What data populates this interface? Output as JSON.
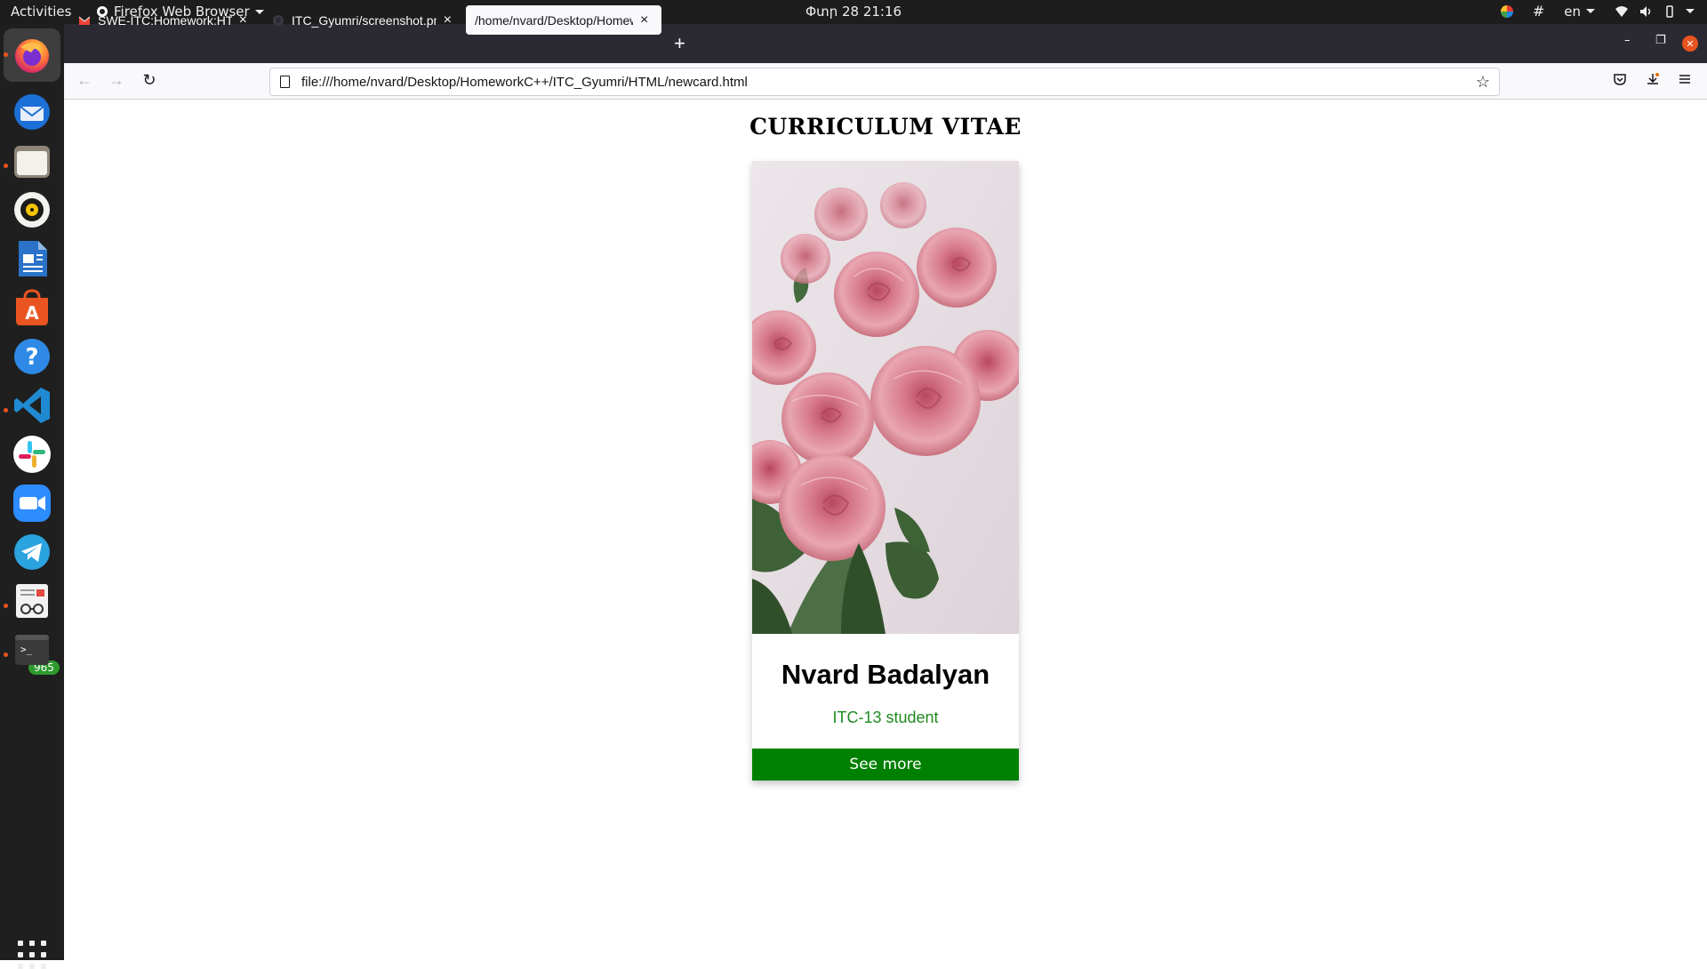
{
  "system": {
    "activities": "Activities",
    "app_menu": "Firefox Web Browser",
    "clock": "Փտր 28  21:16",
    "language": "en",
    "telegram_badge": "965"
  },
  "dock": {
    "items": [
      "firefox-icon",
      "thunderbird-icon",
      "files-icon",
      "rhythmbox-icon",
      "libreoffice-writer-icon",
      "app-center-icon",
      "help-icon",
      "vscode-icon",
      "slack-icon",
      "zoom-icon",
      "telegram-icon",
      "document-viewer-icon",
      "terminal-icon",
      "show-apps-icon"
    ]
  },
  "browser": {
    "tabs": [
      {
        "title": "SWE-ITC:Homework:HTML",
        "icon": "gmail-icon"
      },
      {
        "title": "ITC_Gyumri/screenshot.png",
        "icon": "github-icon"
      },
      {
        "title": "/home/nvard/Desktop/HomeworkC++",
        "icon": ""
      }
    ],
    "url": "file:///home/nvard/Desktop/HomeworkC++/ITC_Gyumri/HTML/newcard.html"
  },
  "page": {
    "heading": "CURRICULUM VITAE",
    "card": {
      "name": "Nvard Badalyan",
      "role": "ITC-13 student",
      "button": "See more",
      "image": "pink-roses-photo"
    }
  },
  "colors": {
    "button_bg": "#008000",
    "role_text": "#1f8a1f",
    "accent_orange": "#e95420"
  }
}
